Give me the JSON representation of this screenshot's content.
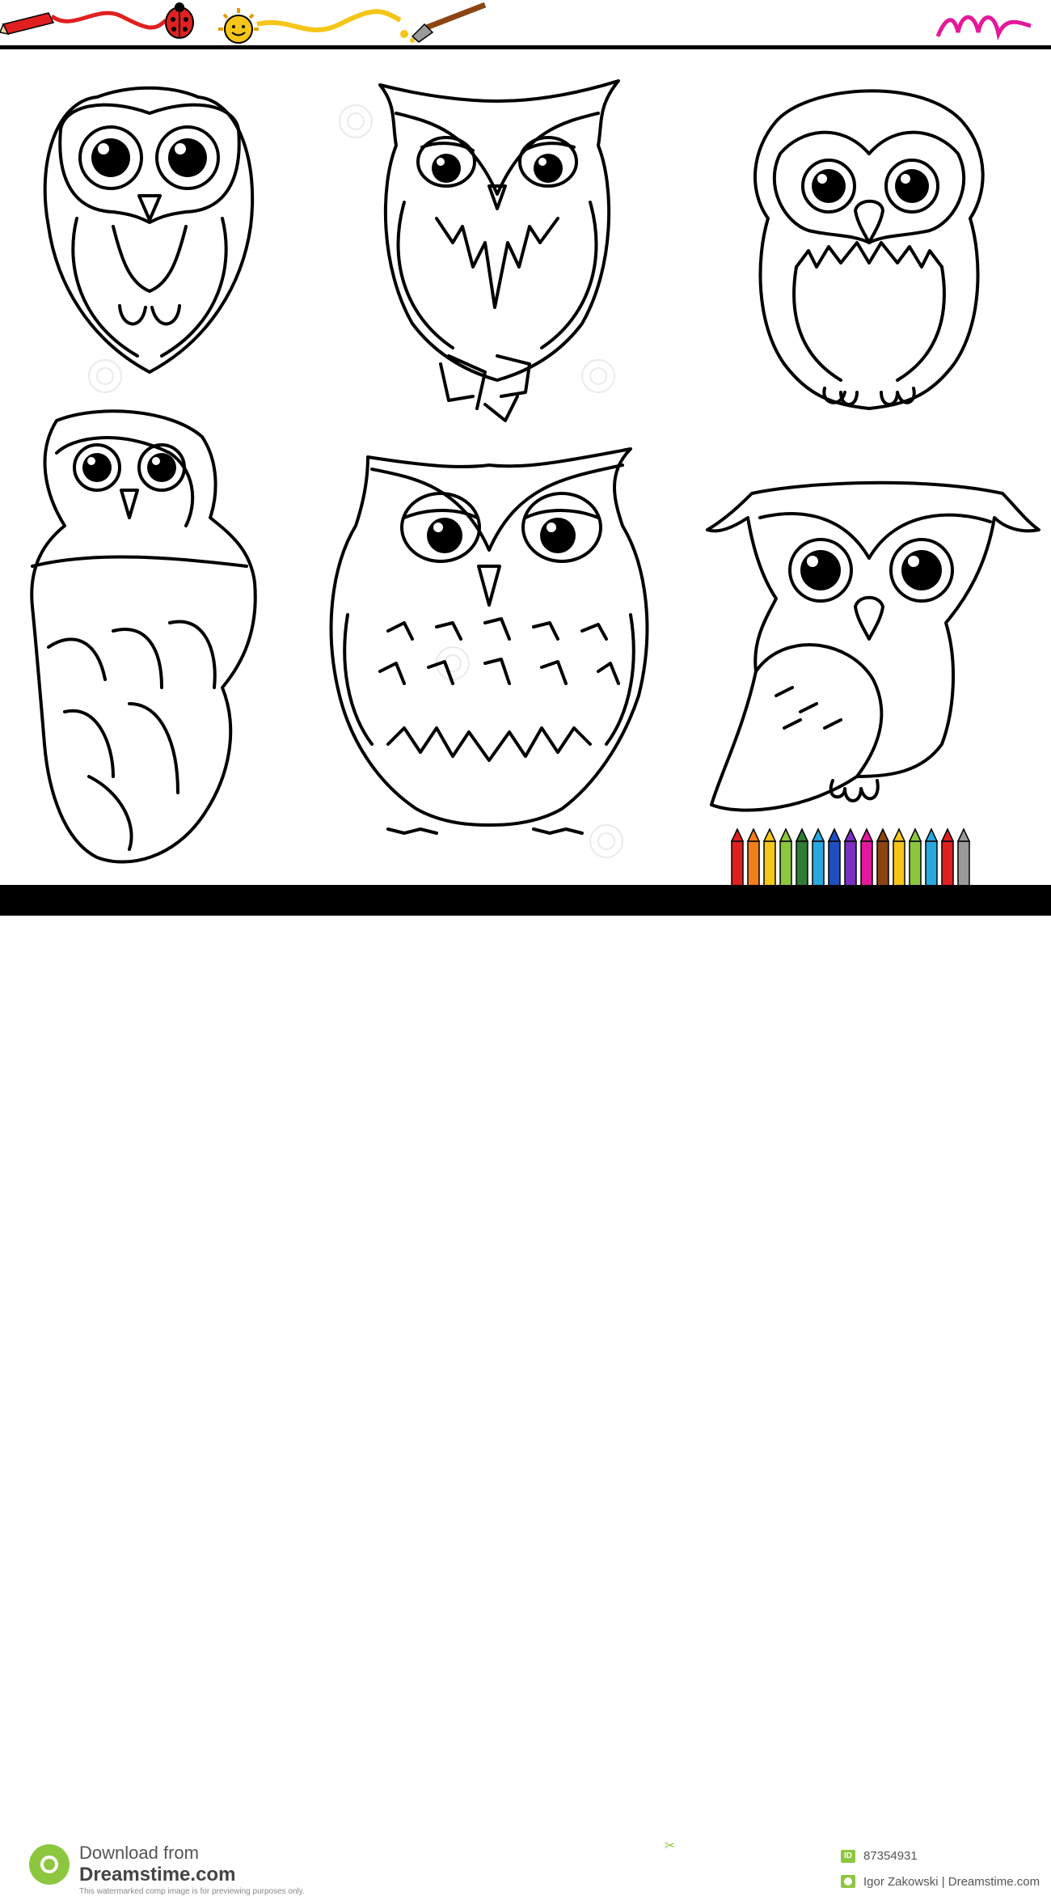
{
  "footer": {
    "download_line1": "Download from",
    "download_line2": "Dreamstime.com",
    "note": "This watermarked comp image is for previewing purposes only.",
    "id_label": "ID",
    "image_id": "87354931",
    "credit": "Igor Zakowski | Dreamstime.com"
  },
  "colors": {
    "brand_green": "#8dc63f",
    "line": "#000000",
    "crayon_red": "#e02020",
    "crayon_yellow": "#f5c518",
    "marker_magenta": "#e5189b"
  },
  "icons": [
    "pencil-icon",
    "ladybug-icon",
    "sun-icon",
    "paintbrush-icon",
    "scribble-icon",
    "crayon-set-icon",
    "scissors-icon",
    "dreamstime-logo-icon"
  ]
}
